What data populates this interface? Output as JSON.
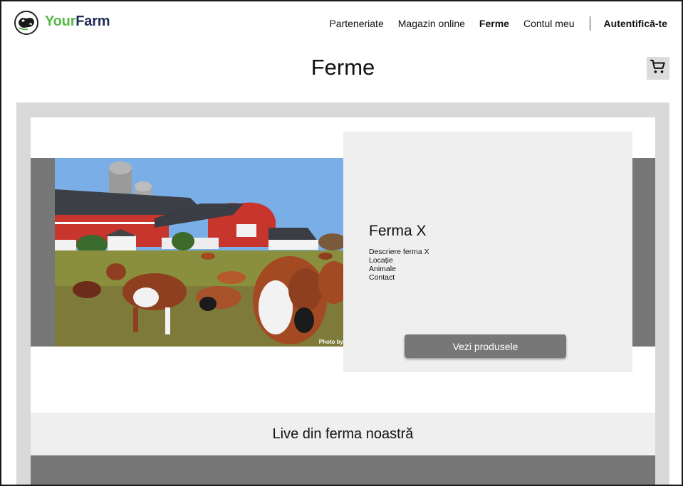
{
  "header": {
    "brand_part1": "Your",
    "brand_part2": "Farm",
    "logo_icon": "cow-logo-icon",
    "nav": [
      {
        "label": "Parteneriate",
        "active": false
      },
      {
        "label": "Magazin online",
        "active": false
      },
      {
        "label": "Ferme",
        "active": true
      },
      {
        "label": "Contul meu",
        "active": false
      }
    ],
    "auth_label": "Autentifică-te"
  },
  "page": {
    "title": "Ferme",
    "cart_icon": "shopping-cart-icon"
  },
  "farm": {
    "name": "Ferma X",
    "description": "Descriere ferma X",
    "location": "Locație",
    "animals": "Animale",
    "contact": "Contact",
    "button_label": "Vezi produsele",
    "photo_credit": "Photo by"
  },
  "live": {
    "title": "Live din ferma noastră"
  },
  "colors": {
    "brand_green": "#58b947",
    "brand_navy": "#1f2c55",
    "panel_gray": "#d9d9d9",
    "band_gray": "#777777",
    "card_gray": "#efefef"
  }
}
